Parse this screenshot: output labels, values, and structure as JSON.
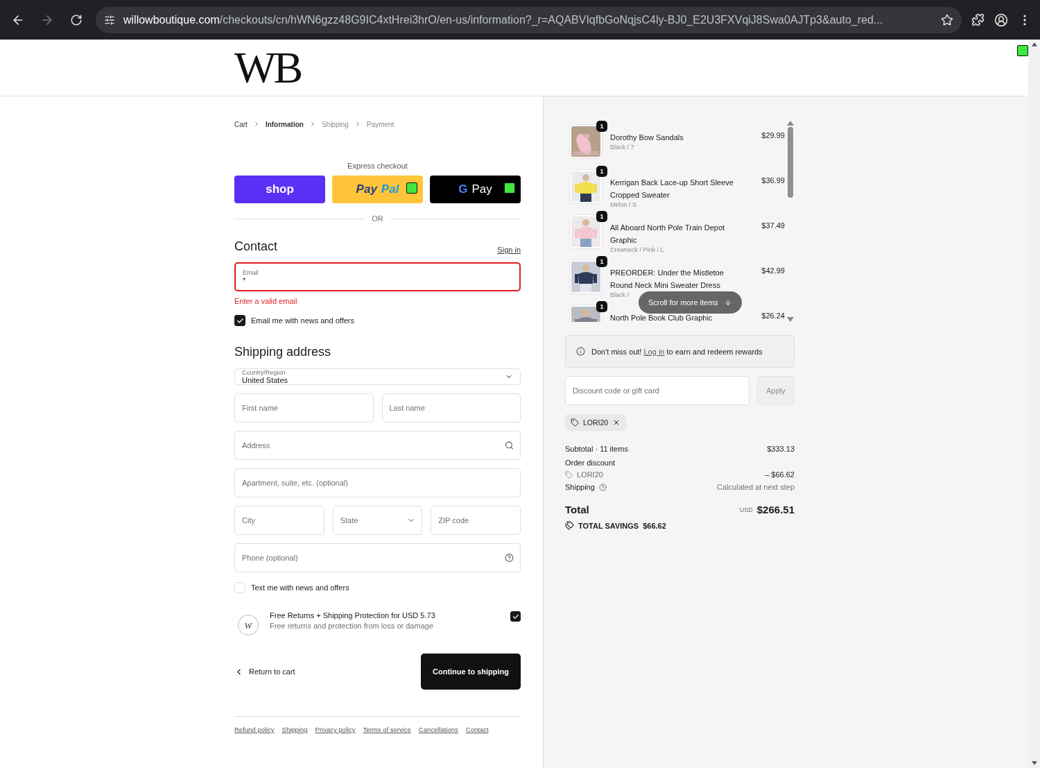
{
  "browser": {
    "url_domain": "willowboutique.com",
    "url_path": "/checkouts/cn/hWN6gzz48G9IC4xtHrei3hrO/en-us/information?_r=AQABVIqfbGoNqjsC4ly-BJ0_E2U3FXVqiJ8Swa0AJTp3&auto_red..."
  },
  "store": {
    "logo": "WB"
  },
  "breadcrumb": [
    {
      "label": "Cart",
      "kind": "done"
    },
    {
      "label": "Information",
      "kind": "current"
    },
    {
      "label": "Shipping",
      "kind": "upcoming"
    },
    {
      "label": "Payment",
      "kind": "upcoming"
    }
  ],
  "express_checkout": {
    "title": "Express checkout",
    "buttons": [
      {
        "kind": "shop",
        "parts": [
          "shop"
        ]
      },
      {
        "kind": "paypal",
        "parts": [
          "Pay",
          "Pal"
        ]
      },
      {
        "kind": "gpay",
        "parts": [
          "G",
          "Pay"
        ]
      }
    ],
    "divider": "OR"
  },
  "contact": {
    "title": "Contact",
    "sign_in": "Sign in",
    "email": {
      "label": "Email",
      "value": "*",
      "invalid": true
    },
    "error": "Enter a valid email",
    "newsletter": {
      "label": "Email me with news and offers",
      "checked": true
    }
  },
  "shipping": {
    "title": "Shipping address",
    "country": {
      "label": "Country/Region",
      "value": "United States"
    },
    "rows": [
      [
        {
          "placeholder": "First name",
          "kind": "text"
        },
        {
          "placeholder": "Last name",
          "kind": "text"
        }
      ],
      [
        {
          "placeholder": "Address",
          "kind": "search"
        }
      ],
      [
        {
          "placeholder": "Apartment, suite, etc. (optional)",
          "kind": "text"
        }
      ],
      [
        {
          "placeholder": "City",
          "kind": "text"
        },
        {
          "placeholder": "State",
          "kind": "select"
        },
        {
          "placeholder": "ZIP code",
          "kind": "text"
        }
      ],
      [
        {
          "placeholder": "Phone (optional)",
          "kind": "help"
        }
      ]
    ],
    "sms": {
      "label": "Text me with news and offers",
      "checked": false
    }
  },
  "protection": {
    "badge": "w",
    "title": "Free Returns + Shipping Protection for USD 5.73",
    "subtitle": "Free returns and protection from loss or damage",
    "checked": true
  },
  "actions": {
    "back": "Return to cart",
    "continue": "Continue to shipping"
  },
  "footer_links": [
    "Refund policy",
    "Shipping",
    "Privacy policy",
    "Terms of service",
    "Cancellations",
    "Contact"
  ],
  "order": {
    "items": [
      {
        "name": "Dorothy Bow Sandals",
        "variant": "Black / 7",
        "price": "$29.99",
        "quantity": "1"
      },
      {
        "name": "Kerrigan Back Lace-up Short Sleeve Cropped Sweater",
        "variant": "Melon / S",
        "price": "$36.99",
        "quantity": "1"
      },
      {
        "name": "All Aboard North Pole Train Depot Graphic",
        "variant": "Crewneck / Pink / L",
        "price": "$37.49",
        "quantity": "1"
      },
      {
        "name": "PREORDER: Under the Mistletoe Round Neck Mini Sweater Dress",
        "variant": "Black /",
        "price": "$42.99",
        "quantity": "1"
      },
      {
        "name": "North Pole Book Club Graphic",
        "price": "$26.24",
        "quantity": "1"
      }
    ],
    "scroll_hint": "Scroll for more items",
    "rewards": {
      "before": "Don't miss out!",
      "link": "Log in",
      "after": "to earn and redeem rewards"
    },
    "discount": {
      "placeholder": "Discount code or gift card",
      "apply": "Apply"
    },
    "applied_code": "LORI20",
    "summary": {
      "subtotal_label": "Subtotal · 11 items",
      "subtotal": "$333.13",
      "discount_label": "Order discount",
      "discount_code": "LORI20",
      "discount": "– $66.62",
      "shipping_label": "Shipping",
      "shipping": "Calculated at next step",
      "total_label": "Total",
      "currency": "USD",
      "total": "$266.51",
      "savings_label": "TOTAL SAVINGS",
      "savings": "$66.62"
    }
  }
}
